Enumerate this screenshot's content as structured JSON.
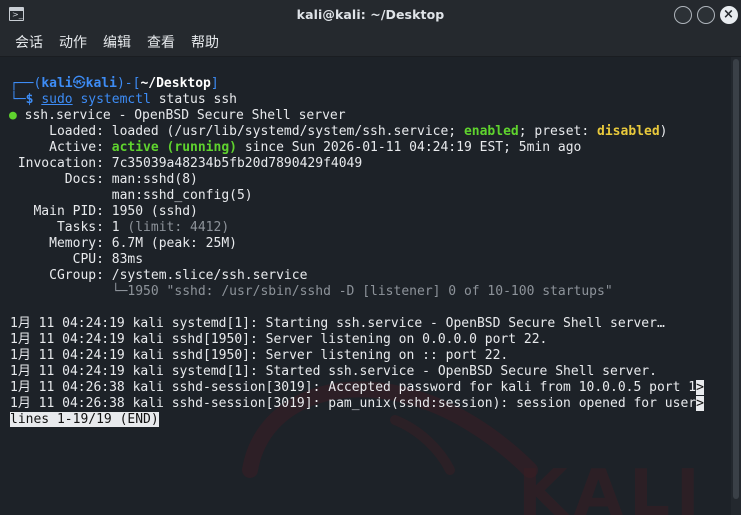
{
  "window": {
    "title": "kali@kali: ~/Desktop",
    "menu": [
      "会话",
      "动作",
      "编辑",
      "查看",
      "帮助"
    ]
  },
  "colors": {
    "accent_blue": "#3d8cf5",
    "success_green": "#5fd32e",
    "warning_yellow": "#e8c93c",
    "muted_grey": "#8d939a"
  },
  "prompt": {
    "corner_top": "┌──(",
    "user": "kali",
    "at": "㉿",
    "host": "kali",
    "mid": ")-[",
    "path": "~/Desktop",
    "close": "]",
    "corner_bottom": "└─",
    "dollar": "$",
    "cmd_sudo": "sudo",
    "cmd_systemctl": "systemctl",
    "cmd_args": "status ssh"
  },
  "service": {
    "bullet": "●",
    "header": "ssh.service - OpenBSD Secure Shell server",
    "loaded_label": "     Loaded:",
    "loaded_pre": "loaded (/usr/lib/systemd/system/ssh.service; ",
    "loaded_enabled": "enabled",
    "loaded_mid": "; preset: ",
    "loaded_disabled": "disabled",
    "loaded_post": ")",
    "active_label": "     Active:",
    "active_state": "active (running)",
    "active_since": "since Sun 2026-01-11 04:24:19 EST; 5min ago",
    "invocation_label": " Invocation:",
    "invocation": "7c35039a48234b5fb20d7890429f4049",
    "docs_label": "       Docs:",
    "docs_1": "man:sshd(8)",
    "docs_2": "             man:sshd_config(5)",
    "mainpid_label": "   Main PID:",
    "mainpid": "1950 (sshd)",
    "tasks_label": "      Tasks:",
    "tasks": "1",
    "tasks_limit": "(limit: 4412)",
    "memory_label": "     Memory:",
    "memory": "6.7M (peak: 25M)",
    "cpu_label": "        CPU:",
    "cpu": "83ms",
    "cgroup_label": "     CGroup:",
    "cgroup": "/system.slice/ssh.service",
    "cgroup_tree_prefix": "             └─",
    "cgroup_proc": "1950 \"sshd: /usr/sbin/sshd -D [listener] 0 of 10-100 startups\""
  },
  "log_lines": [
    "1月 11 04:24:19 kali systemd[1]: Starting ssh.service - OpenBSD Secure Shell server…",
    "1月 11 04:24:19 kali sshd[1950]: Server listening on 0.0.0.0 port 22.",
    "1月 11 04:24:19 kali sshd[1950]: Server listening on :: port 22.",
    "1月 11 04:24:19 kali systemd[1]: Started ssh.service - OpenBSD Secure Shell server.",
    "1月 11 04:26:38 kali sshd-session[3019]: Accepted password for kali from 10.0.0.5 port 1",
    "1月 11 04:26:38 kali sshd-session[3019]: pam_unix(sshd:session): session opened for user"
  ],
  "truncation_marker": ">",
  "pager_status": "lines 1-19/19 (END)"
}
